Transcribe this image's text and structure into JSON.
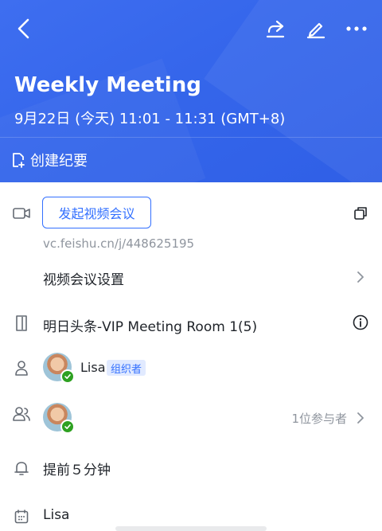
{
  "header": {
    "title": "Weekly Meeting",
    "time": "9月22日 (今天) 11:01 - 11:31 (GMT+8)",
    "create_notes_label": "创建纪要",
    "icons": [
      "back-icon",
      "share-icon",
      "edit-icon",
      "more-icon"
    ]
  },
  "video": {
    "button_label": "发起视频会议",
    "link": "vc.feishu.cn/j/448625195",
    "settings_label": "视频会议设置"
  },
  "room": {
    "name": "明日头条-VIP Meeting Room 1(5)"
  },
  "organizer": {
    "name": "Lisa",
    "tag": "组织者"
  },
  "attendees": {
    "count_label": "1位参与者"
  },
  "reminder": {
    "label": "提前５分钟"
  },
  "calendar": {
    "owner": "Lisa"
  },
  "colors": {
    "header_blue": "#3566eb",
    "accent": "#3370ff",
    "check_green": "#2ea121"
  }
}
